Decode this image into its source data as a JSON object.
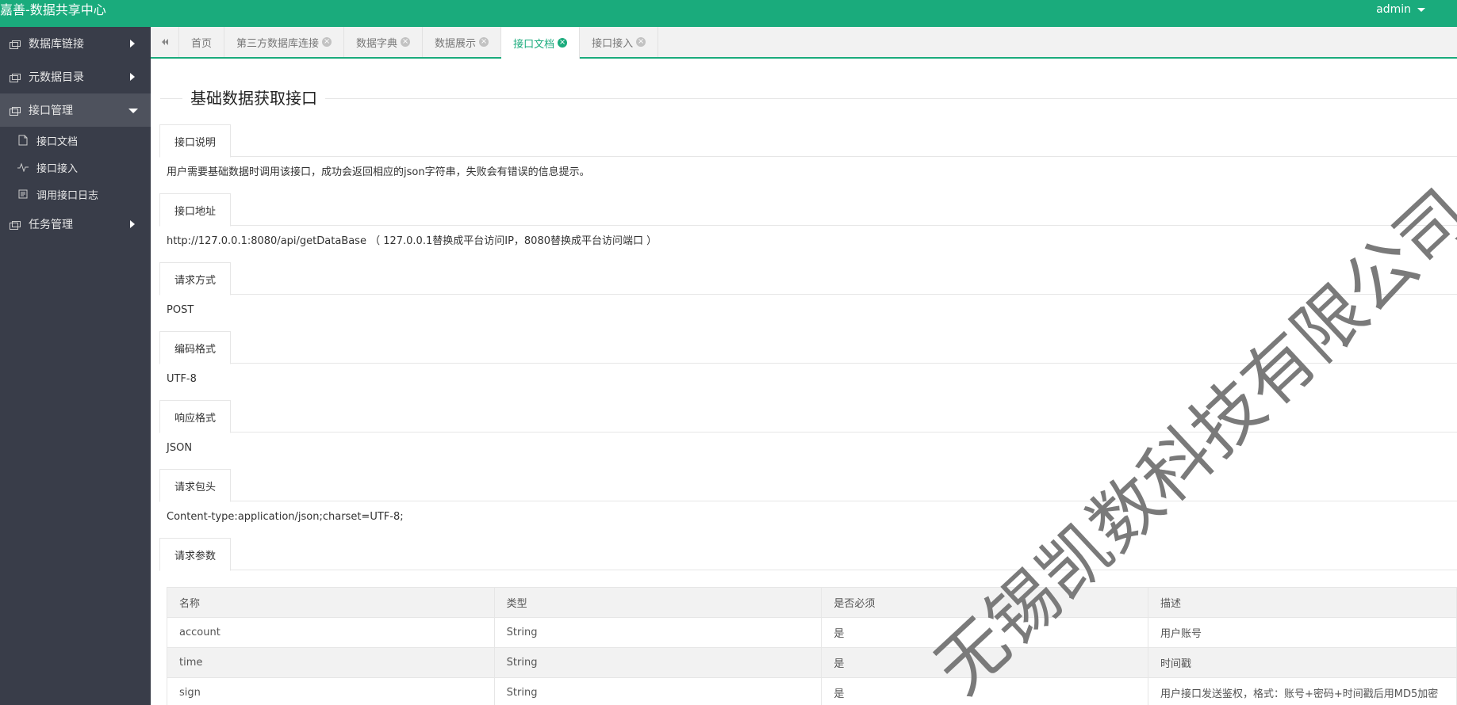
{
  "header": {
    "title": "嘉善-数据共享中心",
    "user": "admin"
  },
  "sidebar": {
    "items": [
      {
        "label": "数据库链接",
        "icon": "server-icon",
        "expanded": false
      },
      {
        "label": "元数据目录",
        "icon": "server-icon",
        "expanded": false
      },
      {
        "label": "接口管理",
        "icon": "server-icon",
        "expanded": true,
        "children": [
          {
            "label": "接口文档",
            "icon": "document-icon"
          },
          {
            "label": "接口接入",
            "icon": "pulse-icon"
          },
          {
            "label": "调用接口日志",
            "icon": "log-icon"
          }
        ]
      },
      {
        "label": "任务管理",
        "icon": "server-icon",
        "expanded": false
      }
    ]
  },
  "tabs": {
    "back_icon": "double-left-icon",
    "items": [
      {
        "label": "首页",
        "closable": false,
        "active": false
      },
      {
        "label": "第三方数据库连接",
        "closable": true,
        "active": false
      },
      {
        "label": "数据字典",
        "closable": true,
        "active": false
      },
      {
        "label": "数据展示",
        "closable": true,
        "active": false
      },
      {
        "label": "接口文档",
        "closable": true,
        "active": true
      },
      {
        "label": "接口接入",
        "closable": true,
        "active": false
      }
    ],
    "close_glyph": "×"
  },
  "page": {
    "title": "基础数据获取接口",
    "sections": [
      {
        "label": "接口说明",
        "text": "用户需要基础数据时调用该接口，成功会返回相应的json字符串，失败会有错误的信息提示。"
      },
      {
        "label": "接口地址",
        "text": "http://127.0.0.1:8080/api/getDataBase （ 127.0.0.1替换成平台访问IP，8080替换成平台访问端口 ）"
      },
      {
        "label": "请求方式",
        "text": "POST"
      },
      {
        "label": "编码格式",
        "text": "UTF-8"
      },
      {
        "label": "响应格式",
        "text": "JSON"
      },
      {
        "label": "请求包头",
        "text": "Content-type:application/json;charset=UTF-8;"
      },
      {
        "label": "请求参数",
        "text": ""
      }
    ],
    "params_table": {
      "headers": [
        "名称",
        "类型",
        "是否必须",
        "描述"
      ],
      "rows": [
        [
          "account",
          "String",
          "是",
          "用户账号"
        ],
        [
          "time",
          "String",
          "是",
          "时间戳"
        ],
        [
          "sign",
          "String",
          "是",
          "用户接口发送鉴权，格式：账号+密码+时间戳后用MD5加密"
        ]
      ]
    }
  },
  "watermark": "无锡凯数科技有限公司",
  "colors": {
    "accent": "#1aab7c",
    "sidebar_bg": "#393d49",
    "sidebar_active": "#4e525d"
  }
}
